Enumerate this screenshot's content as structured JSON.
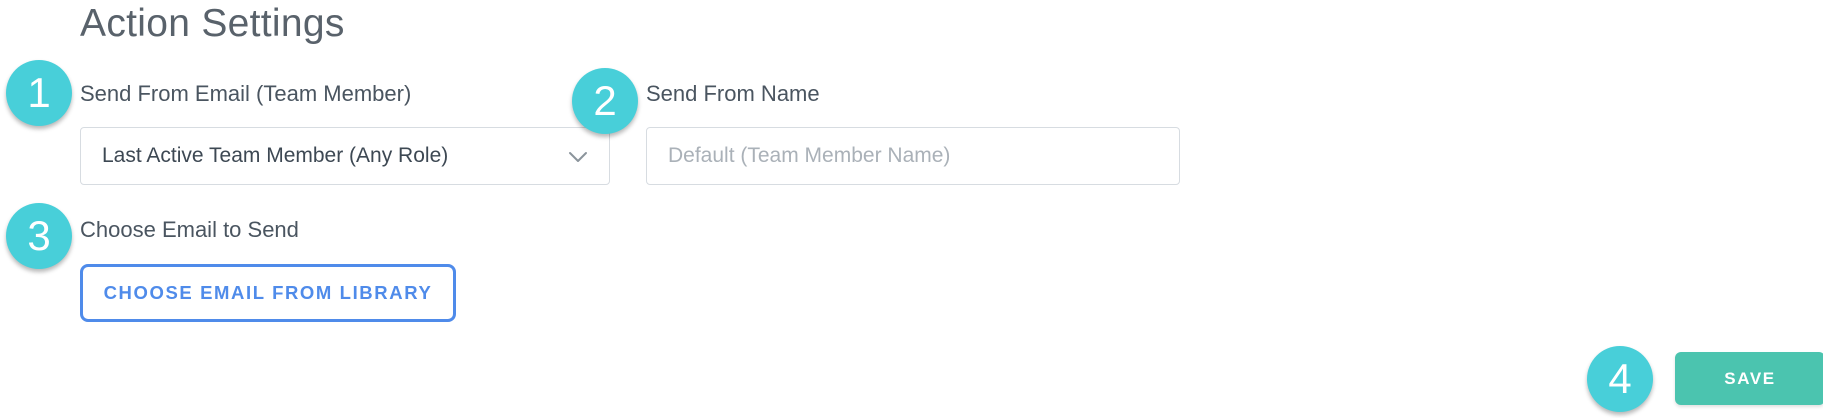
{
  "header": {
    "title": "Action Settings"
  },
  "steps": {
    "step1": "1",
    "step2": "2",
    "step3": "3",
    "step4": "4"
  },
  "send_from_email": {
    "label": "Send From Email (Team Member)",
    "selected_value": "Last Active Team Member (Any Role)",
    "icon": "chevron-down-icon"
  },
  "send_from_name": {
    "label": "Send From Name",
    "value": "",
    "placeholder": "Default (Team Member Name)"
  },
  "choose_email": {
    "label": "Choose Email to Send",
    "button_label": "CHOOSE EMAIL FROM LIBRARY"
  },
  "footer": {
    "save_label": "SAVE"
  },
  "colors": {
    "badge": "#48cfd9",
    "library_button": "#4f8bea",
    "save_button": "#4bc4af",
    "title_text": "#59626b",
    "label_text": "#4a5560"
  }
}
